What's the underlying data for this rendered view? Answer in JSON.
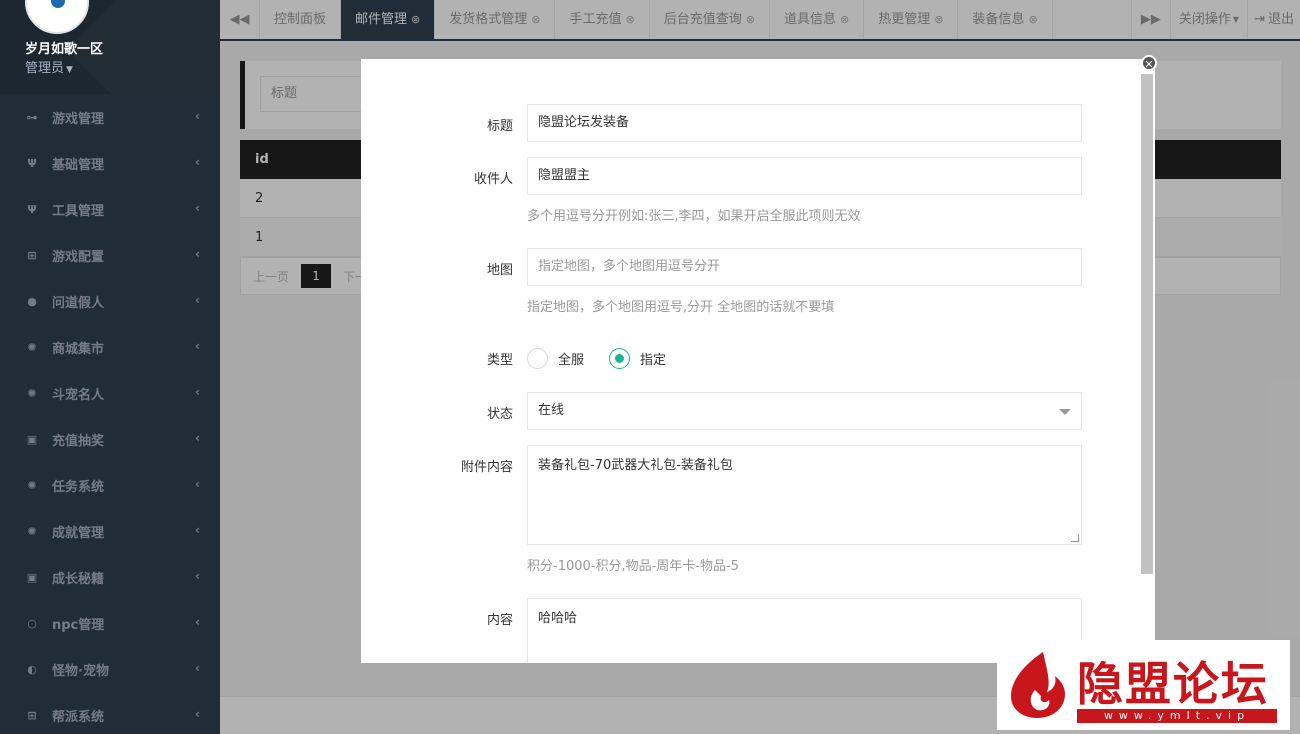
{
  "sidebar": {
    "profile": {
      "name": "岁月如歌一区",
      "role": "管理员"
    },
    "items": [
      {
        "label": "游戏管理",
        "icon": "gamepad-icon"
      },
      {
        "label": "基础管理",
        "icon": "cutlery-icon"
      },
      {
        "label": "工具管理",
        "icon": "cutlery-icon"
      },
      {
        "label": "游戏配置",
        "icon": "table-icon"
      },
      {
        "label": "问道假人",
        "icon": "user-icon"
      },
      {
        "label": "商城集市",
        "icon": "gear-icon"
      },
      {
        "label": "斗宠名人",
        "icon": "gear-icon"
      },
      {
        "label": "充值抽奖",
        "icon": "money-icon"
      },
      {
        "label": "任务系统",
        "icon": "gear-icon"
      },
      {
        "label": "成就管理",
        "icon": "gear-icon"
      },
      {
        "label": "成长秘籍",
        "icon": "money-icon"
      },
      {
        "label": "npc管理",
        "icon": "circle-icon"
      },
      {
        "label": "怪物·宠物",
        "icon": "adjust-icon"
      },
      {
        "label": "帮派系统",
        "icon": "table-icon"
      }
    ]
  },
  "tabs": {
    "items": [
      {
        "label": "控制面板",
        "closable": false,
        "active": false
      },
      {
        "label": "邮件管理",
        "closable": true,
        "active": true
      },
      {
        "label": "发货格式管理",
        "closable": true,
        "active": false
      },
      {
        "label": "手工充值",
        "closable": true,
        "active": false
      },
      {
        "label": "后台充值查询",
        "closable": true,
        "active": false
      },
      {
        "label": "道具信息",
        "closable": true,
        "active": false
      },
      {
        "label": "热更管理",
        "closable": true,
        "active": false
      },
      {
        "label": "装备信息",
        "closable": true,
        "active": false
      }
    ],
    "close_ops": "关闭操作",
    "logout": "退出"
  },
  "page": {
    "search_placeholder": "标题",
    "table": {
      "column": "id",
      "rows": [
        "2",
        "1"
      ]
    },
    "pager": {
      "prev": "上一页",
      "current": "1",
      "next": "下一"
    }
  },
  "modal": {
    "title_label": "标题",
    "title_value": "隐盟论坛发装备",
    "recipient_label": "收件人",
    "recipient_value": "隐盟盟主",
    "recipient_help": "多个用逗号分开例如:张三,李四，如果开启全服此项则无效",
    "map_label": "地图",
    "map_placeholder": "指定地图，多个地图用逗号分开",
    "map_help": "指定地图，多个地图用逗号,分开 全地图的话就不要填",
    "type_label": "类型",
    "type_options": [
      "全服",
      "指定"
    ],
    "type_selected": "指定",
    "status_label": "状态",
    "status_value": "在线",
    "attach_label": "附件内容",
    "attach_value": "装备礼包-70武器大礼包-装备礼包",
    "attach_help": "积分-1000-积分,物品-周年卡-物品-5",
    "content_label": "内容",
    "content_value": "哈哈哈"
  },
  "watermark": {
    "title": "隐盟论坛",
    "url": "www.ymlt.vip"
  },
  "colors": {
    "sidebar": "#2f4050",
    "accent": "#1ab394",
    "brand_red": "#c8161d"
  }
}
